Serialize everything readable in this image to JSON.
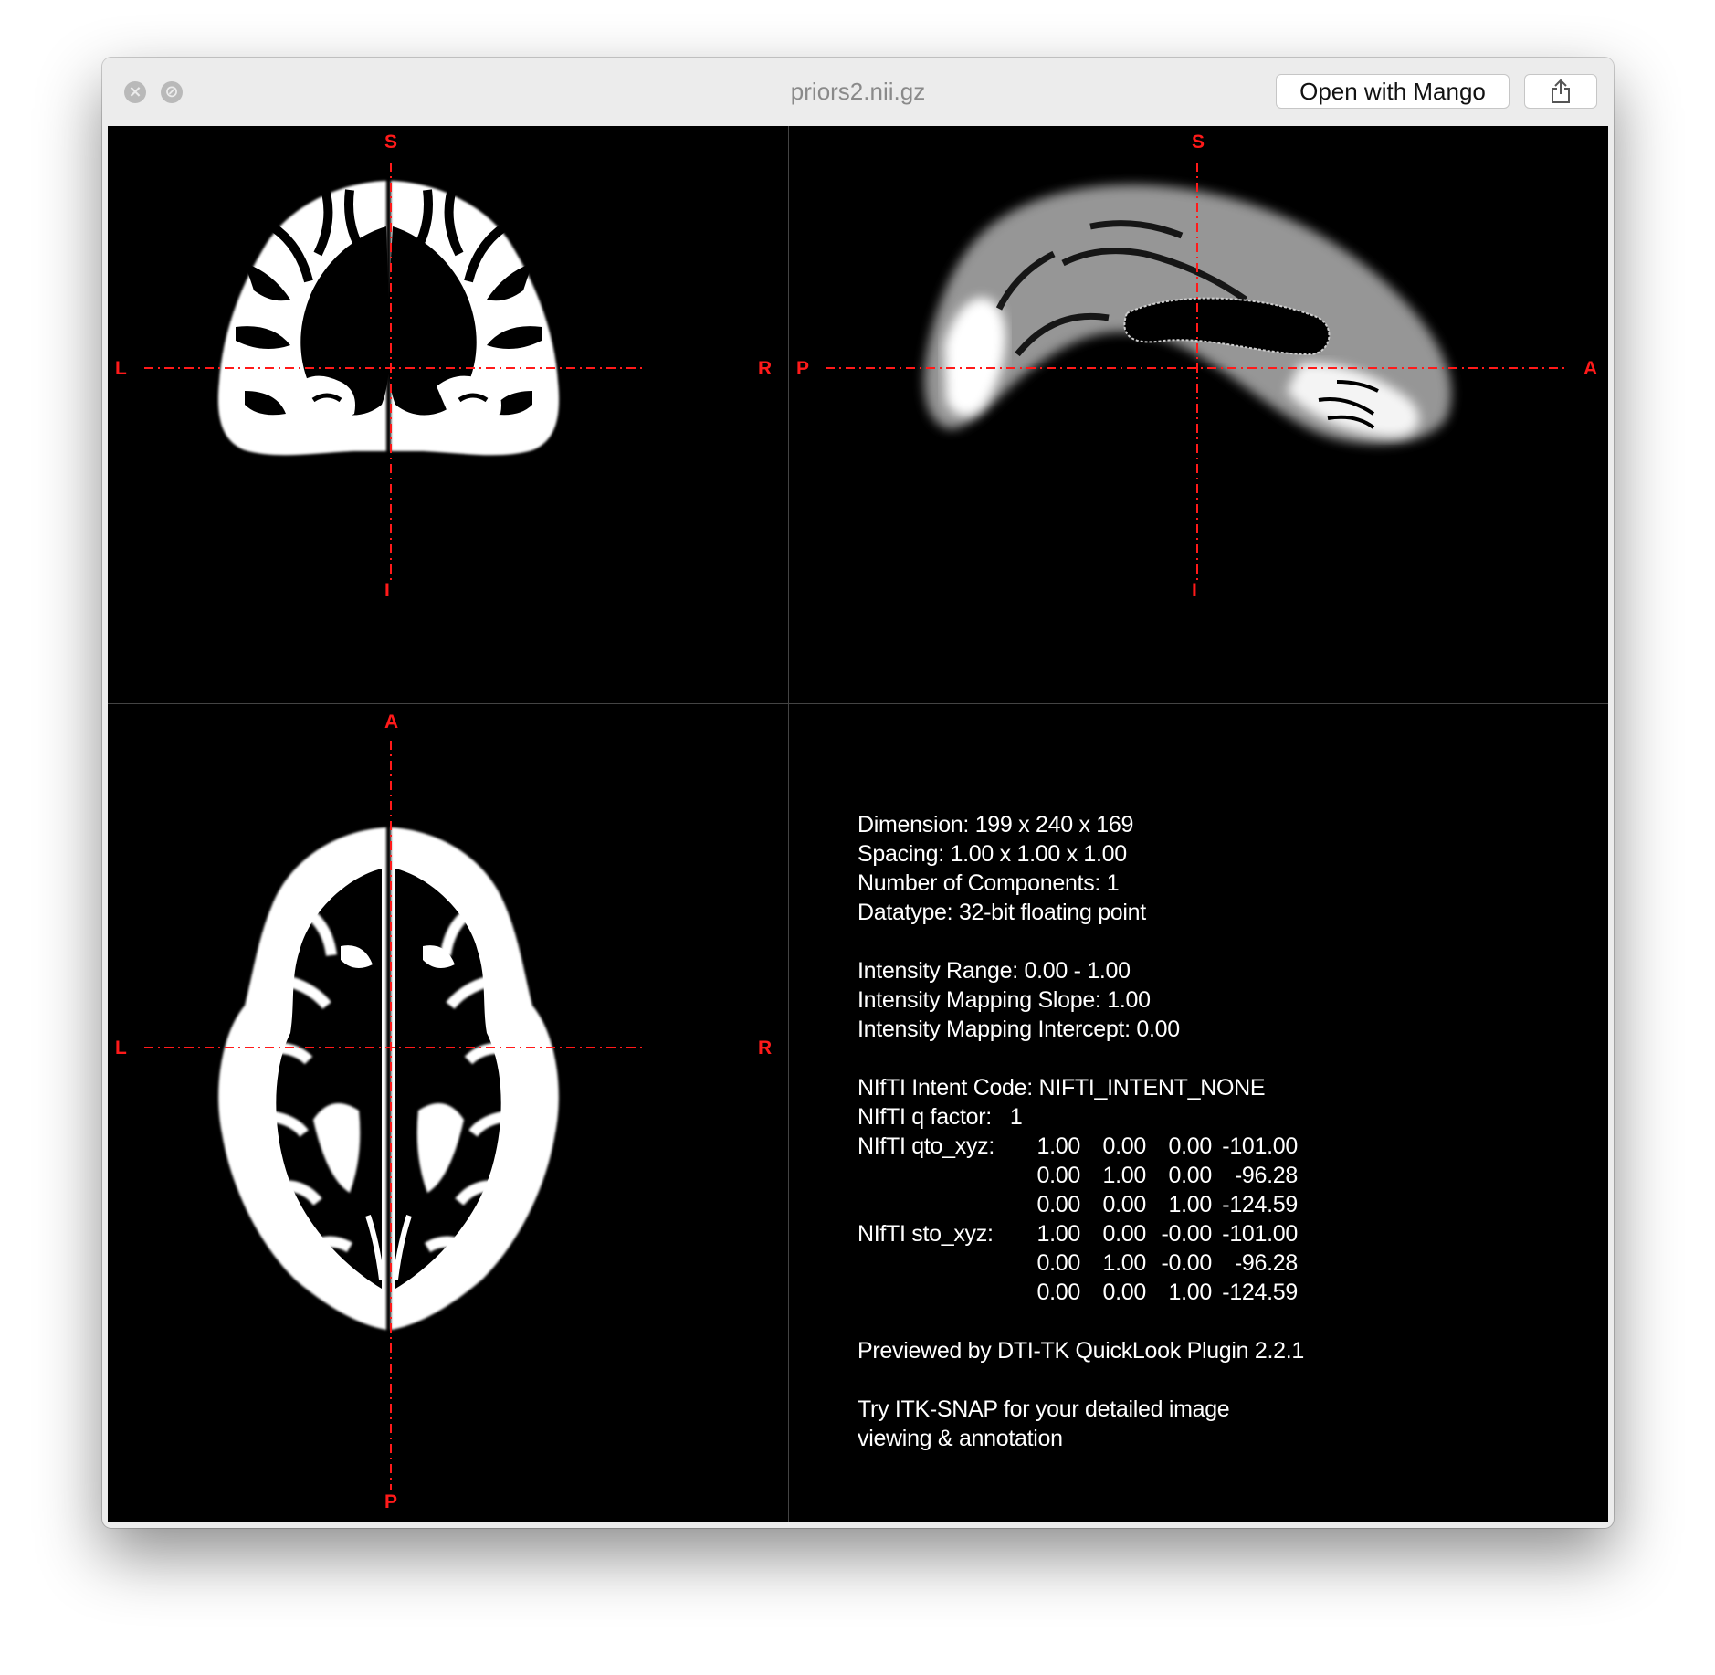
{
  "window": {
    "title": "priors2.nii.gz",
    "open_button_label": "Open with Mango",
    "share_icon": "share-icon",
    "close_icon": "close-icon",
    "minimize_icon": "minimize-icon"
  },
  "views": {
    "coronal": {
      "top": "S",
      "bottom": "I",
      "left": "L",
      "right": "R"
    },
    "sagittal": {
      "top": "S",
      "bottom": "I",
      "left": "P",
      "right": "A"
    },
    "axial": {
      "top": "A",
      "bottom": "P",
      "left": "L",
      "right": "R"
    },
    "crosshair_color": "#ff1a1a"
  },
  "info": {
    "dimension": "Dimension: 199 x 240 x 169",
    "spacing": "Spacing: 1.00 x 1.00 x 1.00",
    "components": "Number of Components: 1",
    "datatype": "Datatype: 32-bit floating point",
    "intensity_range": "Intensity Range: 0.00 - 1.00",
    "mapping_slope": "Intensity Mapping Slope: 1.00",
    "mapping_intercept": "Intensity Mapping Intercept: 0.00",
    "intent_code": "NIfTI Intent Code: NIFTI_INTENT_NONE",
    "q_factor": "NIfTI q factor:   1",
    "qto_label": "NIfTI qto_xyz:",
    "qto": [
      [
        "1.00",
        "0.00",
        "0.00",
        "-101.00"
      ],
      [
        "0.00",
        "1.00",
        "0.00",
        "-96.28"
      ],
      [
        "0.00",
        "0.00",
        "1.00",
        "-124.59"
      ]
    ],
    "sto_label": "NIfTI sto_xyz:",
    "sto": [
      [
        "1.00",
        "0.00",
        "-0.00",
        "-101.00"
      ],
      [
        "0.00",
        "1.00",
        "-0.00",
        "-96.28"
      ],
      [
        "0.00",
        "0.00",
        "1.00",
        "-124.59"
      ]
    ],
    "previewed_by": "Previewed by DTI-TK QuickLook Plugin 2.2.1",
    "try_line1": "Try ITK-SNAP for your detailed image",
    "try_line2": "viewing & annotation"
  }
}
